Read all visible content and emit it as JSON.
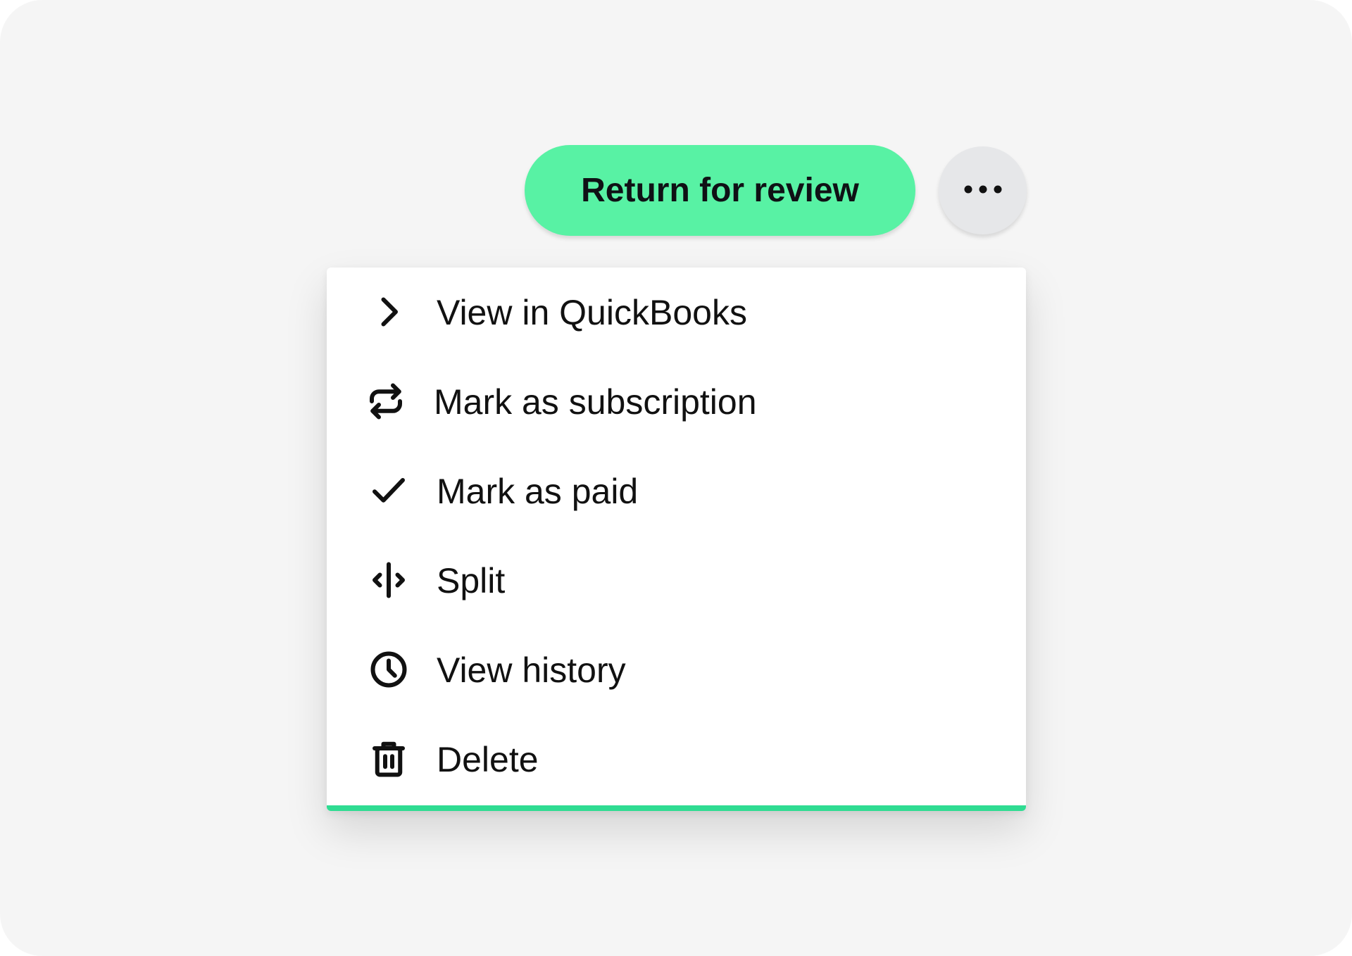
{
  "actions": {
    "primary_label": "Return for review",
    "primary_color": "#58F2A4",
    "more_icon": "more-horizontal-icon"
  },
  "menu": {
    "accent_color": "#2FDC92",
    "items": [
      {
        "label": "View in QuickBooks",
        "icon": "chevron-right-icon"
      },
      {
        "label": "Mark as subscription",
        "icon": "repeat-icon"
      },
      {
        "label": "Mark as paid",
        "icon": "check-icon"
      },
      {
        "label": "Split",
        "icon": "split-icon"
      },
      {
        "label": "View history",
        "icon": "clock-icon"
      },
      {
        "label": "Delete",
        "icon": "trash-icon"
      }
    ]
  }
}
